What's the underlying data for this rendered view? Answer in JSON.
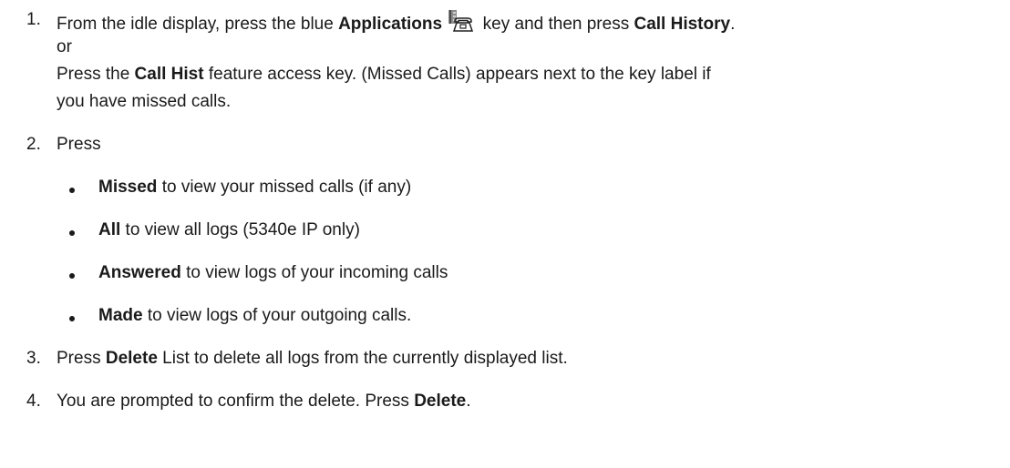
{
  "steps": [
    {
      "number": "1.",
      "line1": {
        "t1": "From the idle display, press the blue ",
        "b1": "Applications",
        "icon": "phone-applications-icon",
        "t2": " key and then press ",
        "b2": "Call History",
        "t3": "."
      },
      "or": "or",
      "line3": {
        "t1": "Press the ",
        "b1": "Call Hist",
        "t2": " feature access key. (Missed Calls) appears next to the key label if"
      },
      "line4": "you have missed calls."
    },
    {
      "number": "2.",
      "text": "Press",
      "bullets": [
        {
          "bold": "Missed",
          "text": " to view your missed calls (if any)"
        },
        {
          "bold": "All",
          "text": " to view all logs (5340e IP only)"
        },
        {
          "bold": "Answered",
          "text": " to view logs of your incoming calls"
        },
        {
          "bold": "Made",
          "text": " to view logs of your outgoing calls."
        }
      ]
    },
    {
      "number": "3.",
      "t1": "Press ",
      "b1": "Delete",
      "t2": " List to delete all logs from the currently displayed list."
    },
    {
      "number": "4.",
      "t1": "You are prompted to confirm the delete. Press ",
      "b1": "Delete",
      "t2": "."
    }
  ]
}
